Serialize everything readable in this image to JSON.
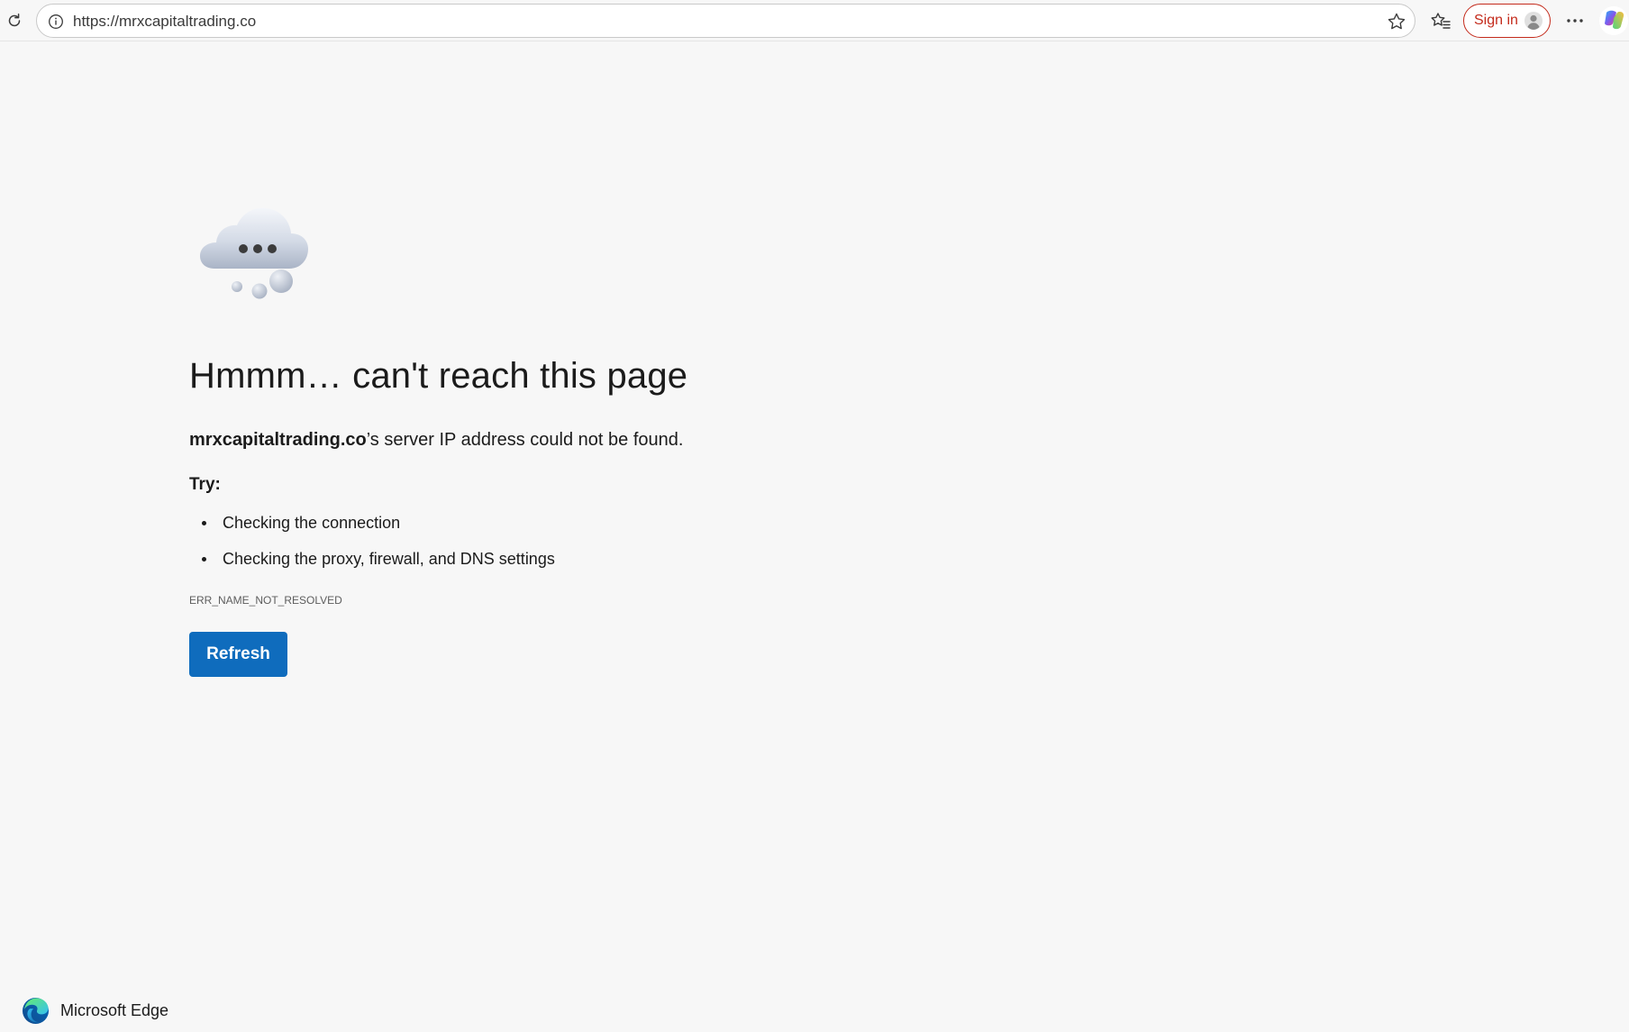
{
  "toolbar": {
    "url": "https://mrxcapitaltrading.co",
    "signin_label": "Sign in"
  },
  "icons": {
    "reload": "reload-icon",
    "site_info": "info-icon",
    "favorite": "star-icon",
    "favorites_hub": "favorites-icon",
    "profile": "profile-avatar-icon",
    "more": "more-icon",
    "copilot": "copilot-icon",
    "illustration": "cloud-error-icon",
    "brand": "edge-logo-icon"
  },
  "error": {
    "title": "Hmmm… can't reach this page",
    "host": "mrxcapitaltrading.co",
    "message_suffix": "’s server IP address could not be found.",
    "try_label": "Try:",
    "suggestions": [
      "Checking the connection",
      "Checking the proxy, firewall, and DNS settings"
    ],
    "code": "ERR_NAME_NOT_RESOLVED",
    "refresh_label": "Refresh"
  },
  "footer": {
    "brand_name": "Microsoft Edge"
  },
  "colors": {
    "page_background": "#f7f7f7",
    "primary_button": "#0f6cbd",
    "signin_accent": "#c42b1c"
  }
}
